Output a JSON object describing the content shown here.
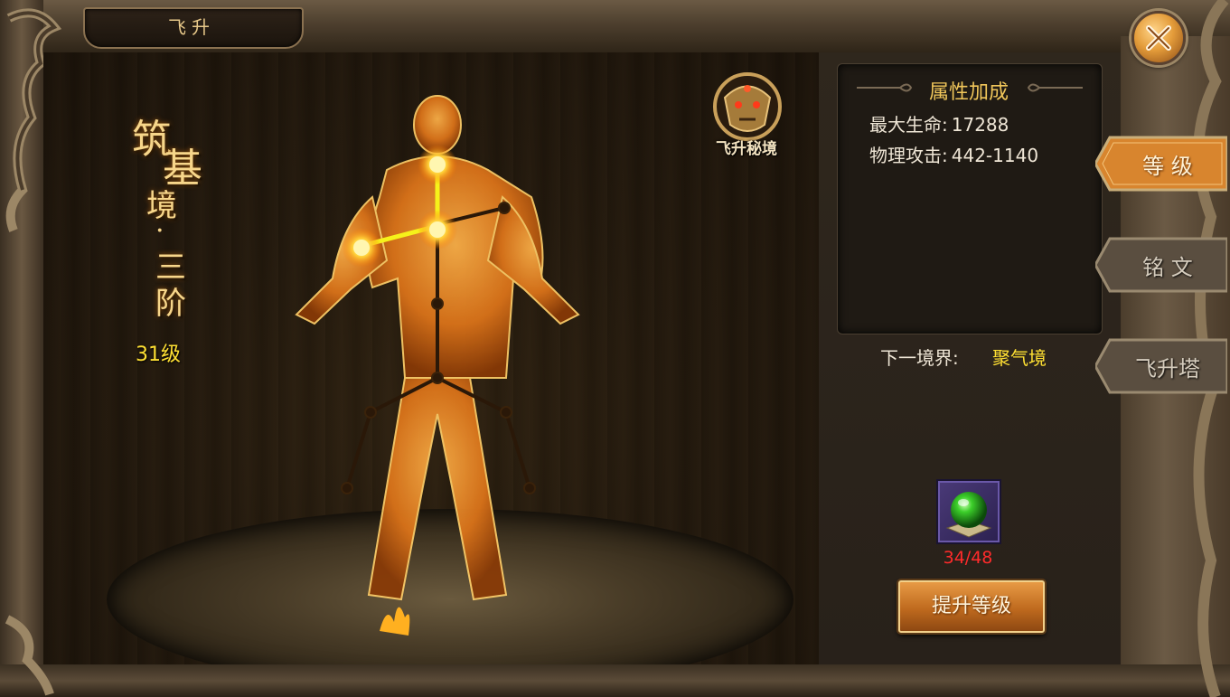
{
  "window": {
    "title": "飞升",
    "close_icon": "close-x-icon"
  },
  "scene": {
    "realm_title": [
      "筑",
      "基",
      "境",
      "·",
      "三",
      "阶"
    ],
    "level": "31级",
    "secret_realm_label": "飞升秘境",
    "secret_realm_icon": "demon-mask-icon"
  },
  "attributes": {
    "header": "属性加成",
    "lines": [
      {
        "label": "最大生命:",
        "value": "17288"
      },
      {
        "label": "物理攻击:",
        "value": "442-1140"
      }
    ],
    "next_realm_label": "下一境界:",
    "next_realm_value": "聚气境"
  },
  "item": {
    "icon": "green-orb-icon",
    "count": "34/48"
  },
  "upgrade_button": "提升等级",
  "tabs": [
    {
      "label": "等 级",
      "active": true
    },
    {
      "label": "铭 文",
      "active": false
    },
    {
      "label": "飞升塔",
      "active": false
    }
  ],
  "colors": {
    "highlight_yellow": "#ffe033",
    "gold_header": "#f0c65a",
    "count_red": "#ff2b2b",
    "glow_orange": "#ff9a1e"
  }
}
